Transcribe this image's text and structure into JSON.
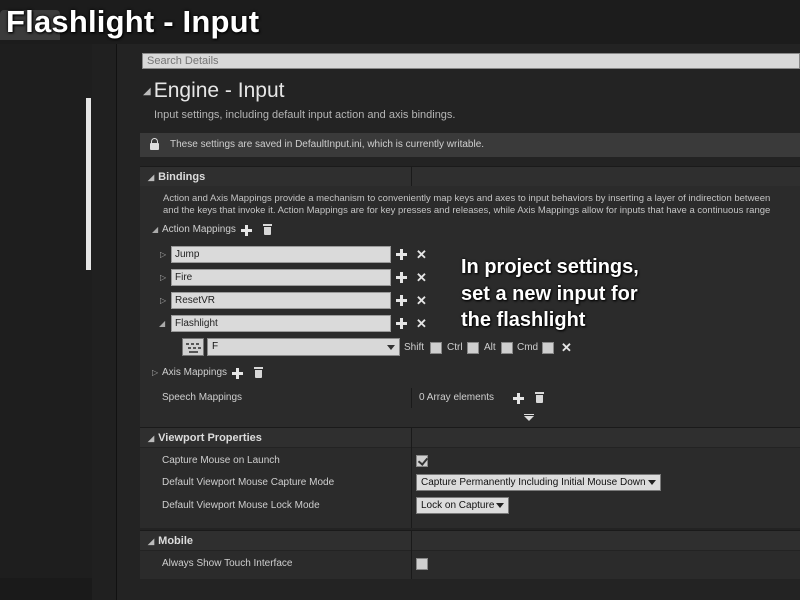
{
  "overlay_title": "Flashlight - Input",
  "search": {
    "placeholder": "Search Details"
  },
  "engine": {
    "title": "Engine - Input",
    "description": "Input settings, including default input action and axis bindings.",
    "notice": "These settings are saved in DefaultInput.ini, which is currently writable."
  },
  "bindings": {
    "header": "Bindings",
    "description_line1": "Action and Axis Mappings provide a mechanism to conveniently map keys and axes to input behaviors by inserting a layer of indirection between",
    "description_line2": "and the keys that invoke it. Action Mappings are for key presses and releases, while Axis Mappings allow for inputs that have a continuous range",
    "action_mappings_label": "Action Mappings",
    "actions": [
      {
        "name": "Jump"
      },
      {
        "name": "Fire"
      },
      {
        "name": "ResetVR"
      },
      {
        "name": "Flashlight"
      }
    ],
    "flashlight_key": {
      "key": "F",
      "modifiers": [
        "Shift",
        "Ctrl",
        "Alt",
        "Cmd"
      ]
    },
    "axis_mappings_label": "Axis Mappings",
    "speech_mappings_label": "Speech Mappings",
    "speech_mappings_value": "0 Array elements"
  },
  "viewport": {
    "header": "Viewport Properties",
    "capture_mouse_label": "Capture Mouse on Launch",
    "capture_mouse_checked": true,
    "capture_mode_label": "Default Viewport Mouse Capture Mode",
    "capture_mode_value": "Capture Permanently Including Initial Mouse Down",
    "lock_mode_label": "Default Viewport Mouse Lock Mode",
    "lock_mode_value": "Lock on Capture"
  },
  "mobile": {
    "header": "Mobile",
    "touch_label": "Always Show Touch Interface",
    "touch_checked": false
  },
  "callout": "In project settings,\nset a new input for\nthe flashlight",
  "icons": {
    "add": "plus-icon",
    "remove": "x-icon",
    "delete_all": "trash-icon",
    "lock": "lock-icon",
    "key": "keyboard-icon"
  }
}
